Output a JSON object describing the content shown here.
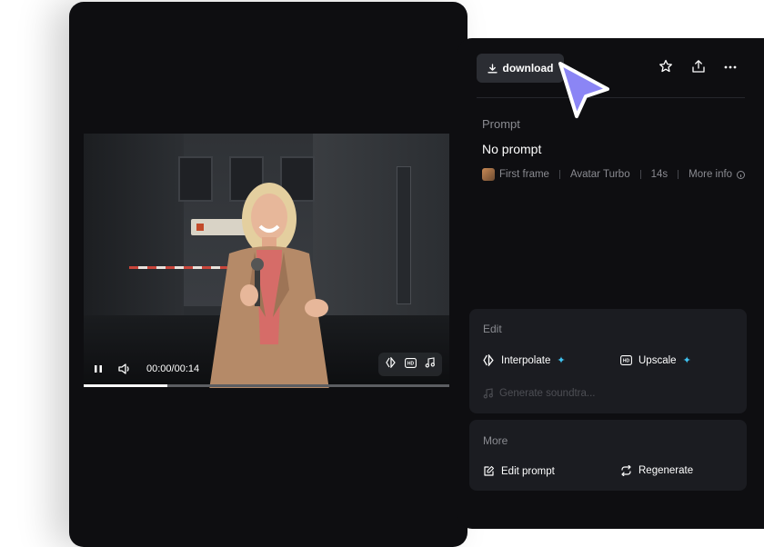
{
  "player": {
    "time": "00:00/00:14",
    "progress_fraction": 0.23
  },
  "header": {
    "download_label": "download",
    "icons": [
      "star-icon",
      "share-icon",
      "more-icon"
    ]
  },
  "prompt": {
    "label": "Prompt",
    "value": "No prompt"
  },
  "meta": {
    "first_frame": "First frame",
    "model": "Avatar Turbo",
    "duration": "14s",
    "more_info": "More info"
  },
  "edit": {
    "title": "Edit",
    "interpolate": "Interpolate",
    "upscale": "Upscale",
    "soundtrack": "Generate soundtra..."
  },
  "more": {
    "title": "More",
    "edit_prompt": "Edit prompt",
    "regenerate": "Regenerate"
  },
  "colors": {
    "background": "#0e0e11",
    "card": "#1b1c21",
    "accent_sparkle": "#3fc2f0",
    "cursor": "#8b85f5"
  }
}
